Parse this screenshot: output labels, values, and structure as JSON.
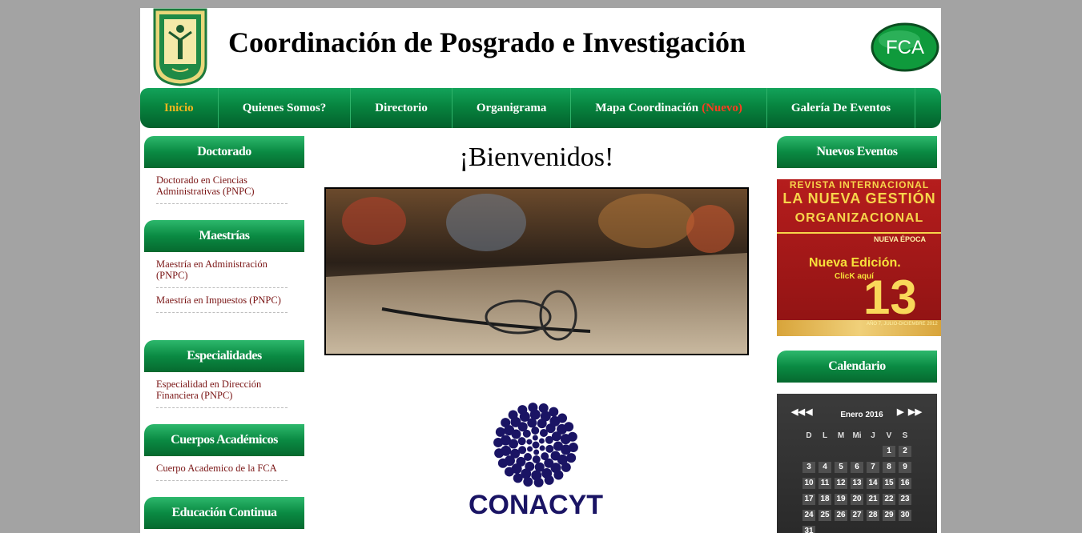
{
  "header": {
    "title": "Coordinación de Posgrado e Investigación",
    "fca_logo_text": "FCA"
  },
  "nav": {
    "items": [
      {
        "label": "Inicio"
      },
      {
        "label": "Quienes Somos?"
      },
      {
        "label": "Directorio"
      },
      {
        "label": "Organigrama"
      },
      {
        "label": "Mapa Coordinación",
        "badge": "(Nuevo)"
      },
      {
        "label": "Galería De Eventos"
      }
    ]
  },
  "left": {
    "doctorado": {
      "title": "Doctorado",
      "links": [
        "Doctorado en Ciencias Administrativas (PNPC)"
      ]
    },
    "maestrias": {
      "title": "Maestrías",
      "links": [
        "Maestría en Administración (PNPC)",
        "Maestría en Impuestos (PNPC)"
      ]
    },
    "especialidades": {
      "title": "Especialidades",
      "links": [
        "Especialidad en Dirección Financiera (PNPC)"
      ]
    },
    "cuerpos": {
      "title": "Cuerpos Académicos",
      "links": [
        "Cuerpo Academico de la FCA"
      ]
    },
    "educacion": {
      "title": "Educación Continua"
    }
  },
  "main": {
    "welcome": "¡Bienvenidos!",
    "conacyt_text": "CONACYT"
  },
  "right": {
    "eventos_title": "Nuevos Eventos",
    "revista": {
      "line1": "REVISTA INTERNACIONAL",
      "line2": "LA NUEVA GESTIÓN",
      "line3": "ORGANIZACIONAL",
      "line4": "NUEVA ÉPOCA",
      "line5": "Nueva Edición.",
      "line6": "ClicK aquí",
      "number": "13",
      "footer": "AÑO 7, JULIO-DICIEMBRE 2012"
    },
    "calendario_title": "Calendario",
    "calendar": {
      "month": "Enero",
      "year": "2016",
      "nav_prev_year": "◀◀",
      "nav_prev": "◀",
      "nav_next": "▶",
      "nav_next_year": "▶▶",
      "weekdays": [
        "D",
        "L",
        "M",
        "Mi",
        "J",
        "V",
        "S"
      ],
      "weeks": [
        [
          "",
          "",
          "",
          "",
          "",
          "1",
          "2"
        ],
        [
          "3",
          "4",
          "5",
          "6",
          "7",
          "8",
          "9"
        ],
        [
          "10",
          "11",
          "12",
          "13",
          "14",
          "15",
          "16"
        ],
        [
          "17",
          "18",
          "19",
          "20",
          "21",
          "22",
          "23"
        ],
        [
          "24",
          "25",
          "26",
          "27",
          "28",
          "29",
          "30"
        ],
        [
          "31",
          "",
          "",
          "",
          "",
          "",
          ""
        ]
      ]
    }
  },
  "colors": {
    "nav_green": "#07843f",
    "active_nav": "#f3b51d",
    "new_badge": "#ff3c20",
    "link_color": "#7a1515",
    "conacyt_blue": "#1a1464"
  }
}
